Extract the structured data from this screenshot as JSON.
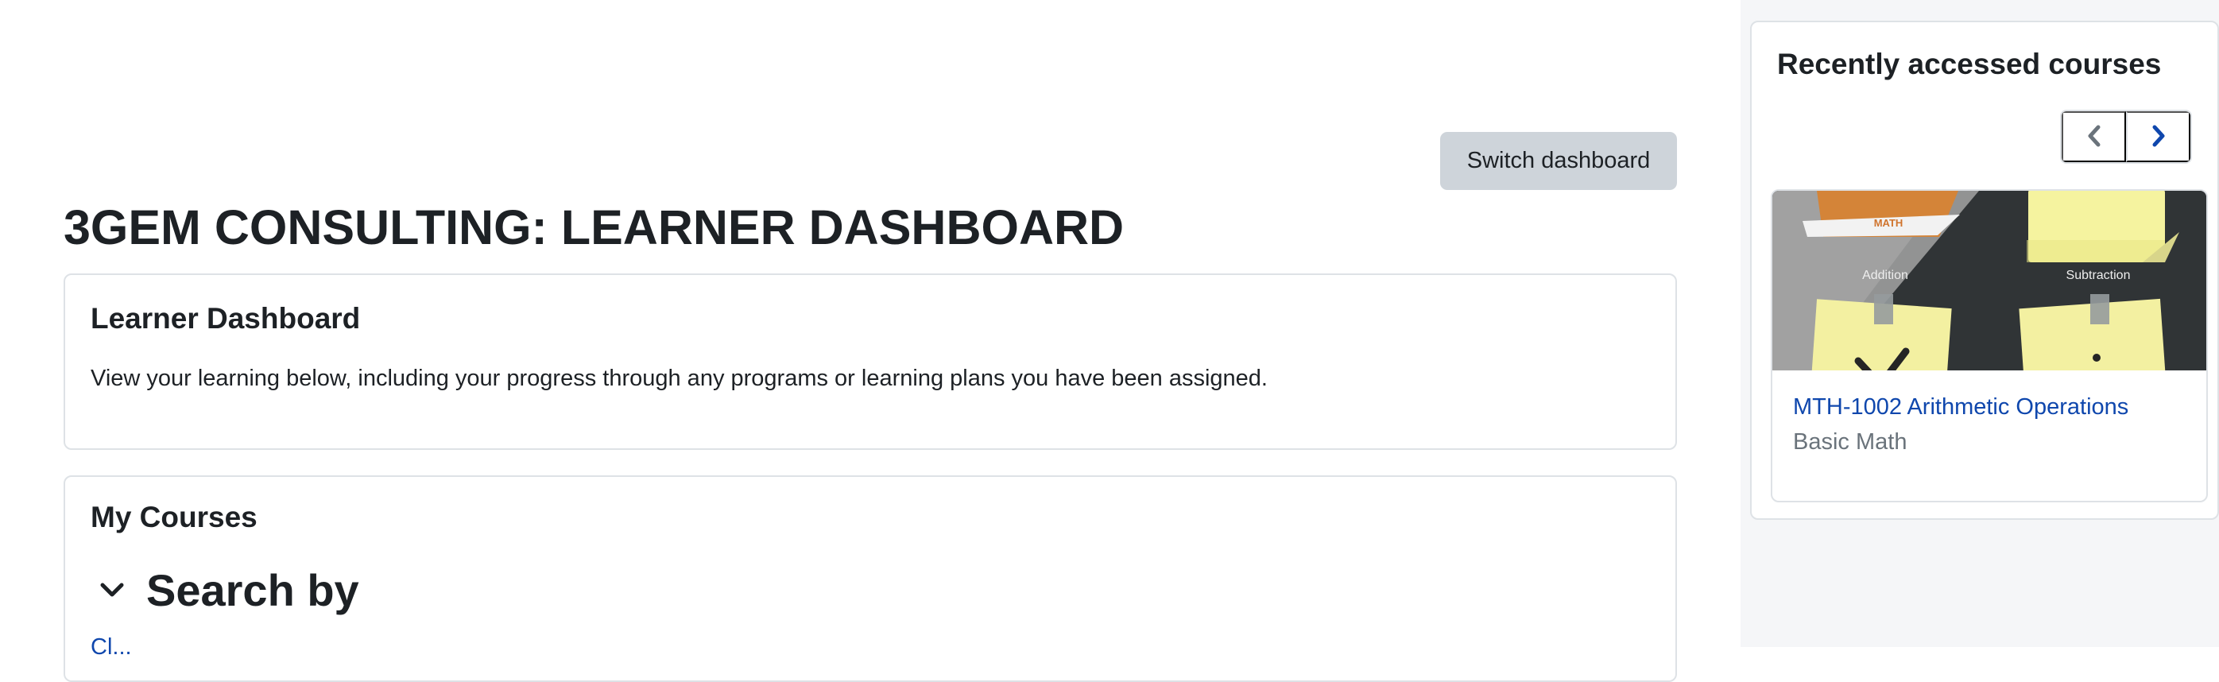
{
  "header": {
    "switch_dashboard_label": "Switch dashboard",
    "page_title": "3GEM CONSULTING: LEARNER DASHBOARD"
  },
  "learner_dashboard": {
    "title": "Learner Dashboard",
    "description": "View your learning below, including your progress through any programs or learning plans you have been assigned."
  },
  "my_courses": {
    "title": "My Courses",
    "search_label": "Search by",
    "clear_link": "Cl..."
  },
  "recent_courses": {
    "title": "Recently accessed courses",
    "prev_icon": "chevron-left-icon",
    "next_icon": "chevron-right-icon",
    "course": {
      "name": "MTH-1002 Arithmetic Operations",
      "category": "Basic Math",
      "image_labels": {
        "banner": "MATH",
        "left": "Addition",
        "right": "Subtraction"
      }
    }
  },
  "colors": {
    "text": "#1d2125",
    "link": "#0f47ad",
    "muted": "#6a737b",
    "border": "#dee2e6",
    "button_bg": "#ced4da",
    "drawer_bg": "#f5f6f8"
  }
}
